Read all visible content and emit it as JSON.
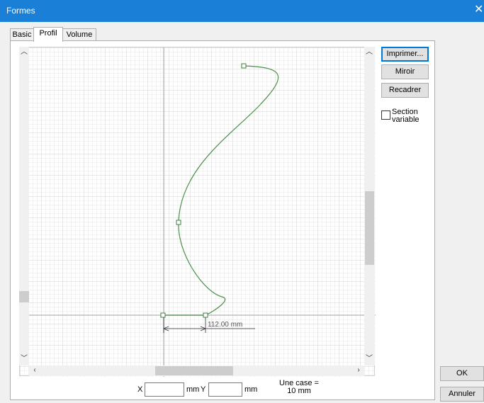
{
  "window": {
    "title": "Formes",
    "close_glyph": "✕"
  },
  "tabs": [
    {
      "label": "Basic",
      "active": false
    },
    {
      "label": "Profil",
      "active": true
    },
    {
      "label": "Volume",
      "active": false
    }
  ],
  "side_buttons": {
    "print": "Imprimer...",
    "mirror": "Miroir",
    "reframe": "Recadrer"
  },
  "section_variable": {
    "label": "Section variable",
    "checked": false
  },
  "dimension_label": "112.00 mm",
  "coords": {
    "x_label": "X",
    "x_value": "",
    "x_unit": "mm",
    "y_label": "Y",
    "y_value": "",
    "y_unit": "mm"
  },
  "scale_note": {
    "line1": "Une case =",
    "line2": "10 mm"
  },
  "dialog_buttons": {
    "ok": "OK",
    "cancel": "Annuler"
  },
  "icons": {
    "scroll_up": "chevron-up-icon",
    "scroll_down": "chevron-down-icon",
    "scroll_left": "chevron-left-icon",
    "scroll_right": "chevron-right-icon"
  },
  "colors": {
    "title_bar": "#1a7fd6",
    "grid_minor": "#e4e4e4",
    "grid_major": "#d0d0d0",
    "axis": "#bfbfbf",
    "curve": "#4a8f4a",
    "dimension": "#333333"
  }
}
